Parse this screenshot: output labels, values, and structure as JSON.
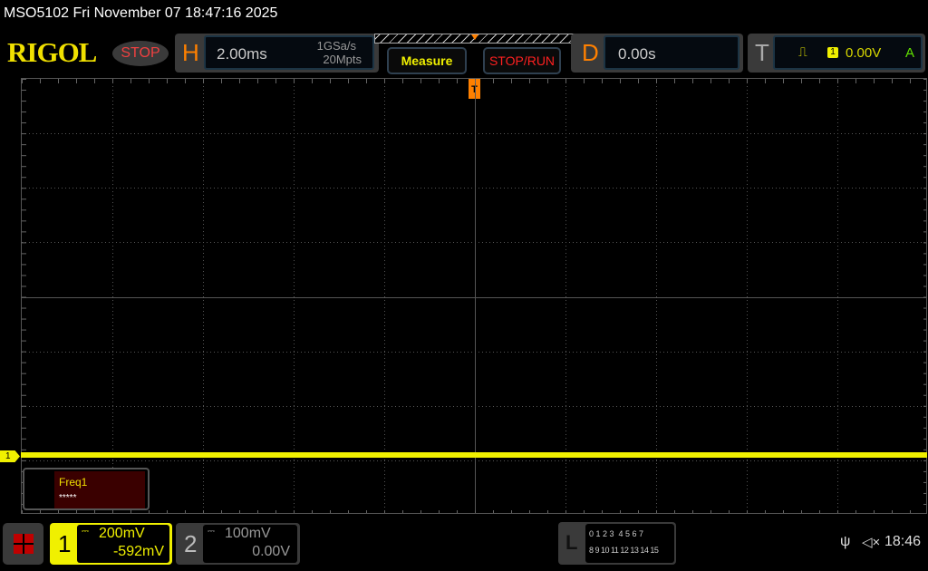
{
  "title": "MSO5102  Fri November 07 18:47:16 2025",
  "logo": "RIGOL",
  "run_state": "STOP",
  "horizontal": {
    "label": "H",
    "timebase": "2.00ms",
    "sample_rate": "1GSa/s",
    "memory_depth": "20Mpts"
  },
  "buttons": {
    "measure": "Measure",
    "stop_run": "STOP/RUN"
  },
  "delay": {
    "label": "D",
    "value": "0.00s"
  },
  "trigger": {
    "label": "T",
    "slope_icon": "rising-edge-icon",
    "source": "1",
    "level": "0.00V",
    "mode": "A"
  },
  "measurement": {
    "name": "Freq1",
    "value": "*****"
  },
  "channels": [
    {
      "num": "1",
      "scale": "200mV",
      "offset": "-592mV",
      "coupling_icon": "dc-coupling-icon",
      "color": "#f0f000",
      "active": true
    },
    {
      "num": "2",
      "scale": "100mV",
      "offset": "0.00V",
      "coupling_icon": "dc-coupling-icon",
      "color": "#888888",
      "active": false
    }
  ],
  "ch1_marker": "1",
  "logic": {
    "label": "L",
    "row1": "0 1 2 3  4 5 6 7",
    "row2": "8 9 10 11 12 13 14 15"
  },
  "status": {
    "usb_icon": "usb-icon",
    "mute_icon": "speaker-muted-icon",
    "time": "18:46"
  },
  "grid": {
    "h_divisions": 10,
    "v_divisions": 8
  }
}
